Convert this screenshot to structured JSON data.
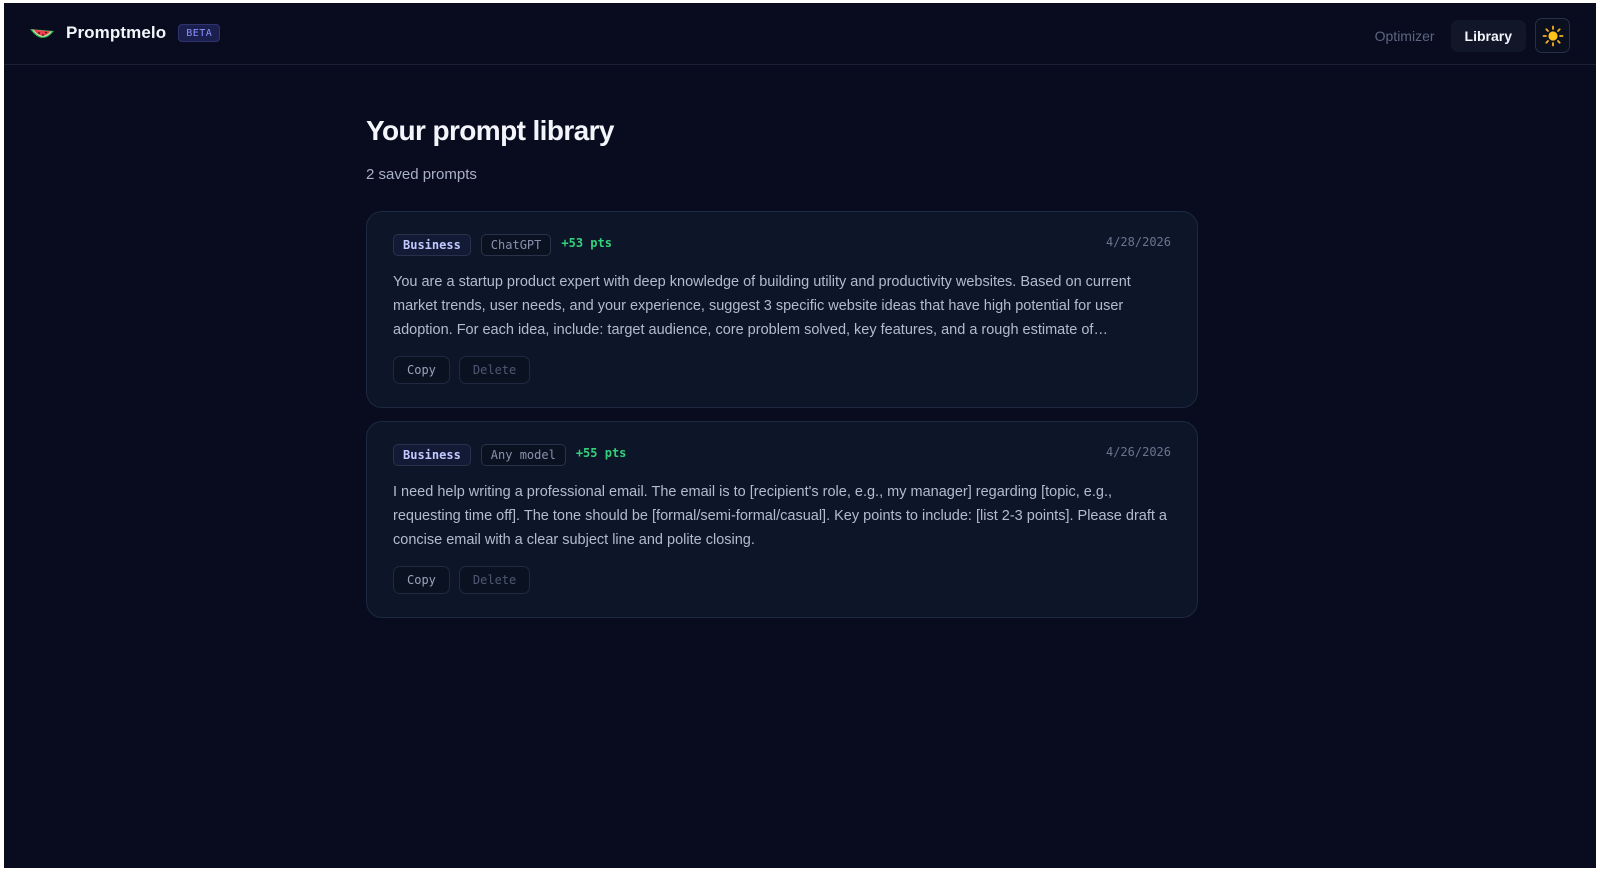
{
  "app": {
    "name": "Promptmelo",
    "badge": "BETA",
    "logo_icon": "watermelon-icon",
    "accent_color": "#8b93ff"
  },
  "nav": {
    "items": [
      {
        "label": "Optimizer",
        "active": false
      },
      {
        "label": "Library",
        "active": true
      }
    ],
    "theme_toggle_icon": "sun-icon"
  },
  "page": {
    "title": "Your prompt library",
    "subtitle": "2 saved prompts"
  },
  "prompts": [
    {
      "category": "Business",
      "model": "ChatGPT",
      "points": "+53 pts",
      "date": "4/28/2026",
      "text": "You are a startup product expert with deep knowledge of building utility and productivity websites. Based on current market trends, user needs, and your experience, suggest 3 specific website ideas that have high potential for user adoption. For each idea, include: target audience, core problem solved, key features, and a rough estimate of…",
      "copy_label": "Copy",
      "delete_label": "Delete"
    },
    {
      "category": "Business",
      "model": "Any model",
      "points": "+55 pts",
      "date": "4/26/2026",
      "text": "I need help writing a professional email. The email is to [recipient's role, e.g., my manager] regarding [topic, e.g., requesting time off]. The tone should be [formal/semi-formal/casual]. Key points to include: [list 2-3 points]. Please draft a concise email with a clear subject line and polite closing.",
      "copy_label": "Copy",
      "delete_label": "Delete"
    }
  ]
}
